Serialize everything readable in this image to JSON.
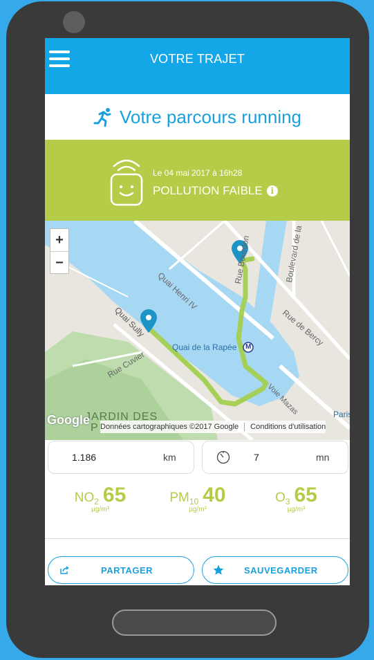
{
  "header": {
    "title": "VOTRE TRAJET"
  },
  "subtitle": "Votre parcours running",
  "pollution": {
    "date": "Le 04 mai 2017 à 16h28",
    "level": "POLLUTION FAIBLE",
    "info_glyph": "i"
  },
  "map": {
    "zoom_in": "+",
    "zoom_out": "−",
    "labels": {
      "quai_henri": "Quai Henri IV",
      "rue_bourdon": "Rue Bourdon",
      "boulevard": "Boulevard de la",
      "rue_bercy": "Rue de Bercy",
      "quai_sully": "Quai Sully",
      "rue_cuvier": "Rue Cuvier",
      "quai_rapee": "Quai de la Rapée",
      "metro": "M",
      "voie_mazas": "Voie Mazas",
      "paris": "Paris",
      "jardin": "JARDIN DES",
      "jardin2": "P"
    },
    "google": "Google",
    "attribution": "Données cartographiques ©2017 Google",
    "terms": "Conditions d'utilisation"
  },
  "stats": {
    "distance_value": "1.186",
    "distance_unit": "km",
    "duration_value": "7",
    "duration_unit": "mn"
  },
  "pollutants": [
    {
      "name": "NO",
      "sub": "2",
      "value": "65",
      "unit": "µg/m³"
    },
    {
      "name": "PM",
      "sub": "10",
      "value": "40",
      "unit": "µg/m³"
    },
    {
      "name": "O",
      "sub": "3",
      "value": "65",
      "unit": "µg/m³"
    }
  ],
  "actions": {
    "share_label": "PARTAGER",
    "save_label": "SAUVEGARDER"
  },
  "colors": {
    "blue": "#14a7e8",
    "green": "#b5cc48",
    "frame": "#3a3a3a",
    "background": "#35a9e9"
  }
}
